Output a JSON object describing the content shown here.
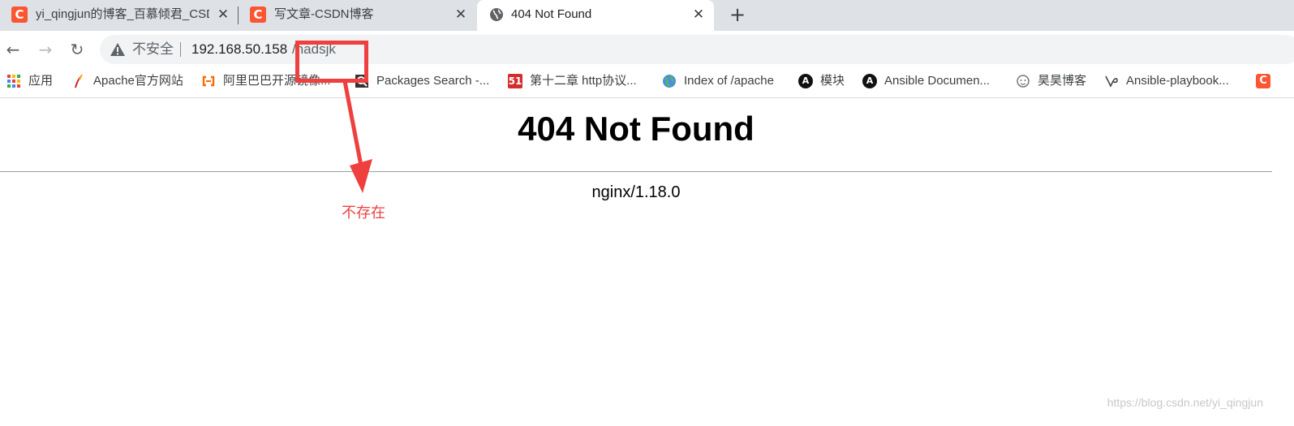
{
  "tabs": [
    {
      "title": "yi_qingjun的博客_百慕倾君_CSD",
      "favicon": "csdn-icon",
      "active": false
    },
    {
      "title": "写文章-CSDN博客",
      "favicon": "csdn-icon",
      "active": false
    },
    {
      "title": "404 Not Found",
      "favicon": "globe-icon",
      "active": true
    }
  ],
  "tab_strip": {
    "close_glyph": "✕",
    "new_tab_glyph": "+"
  },
  "toolbar": {
    "back_glyph": "←",
    "forward_glyph": "→",
    "reload_glyph": "↻"
  },
  "omnibox": {
    "security_label": "不安全",
    "url_host": "192.168.50.158",
    "url_path": "/nadsjk"
  },
  "bookmarks": [
    {
      "label": "应用",
      "icon": "apps-grid-icon"
    },
    {
      "label": "Apache官方网站",
      "icon": "apache-feather-icon"
    },
    {
      "label": "阿里巴巴开源镜像...",
      "icon": "aliyun-icon"
    },
    {
      "label": "Packages Search -...",
      "icon": "packages-icon"
    },
    {
      "label": "第十二章 http协议...",
      "icon": "51cto-icon"
    },
    {
      "label": "Index of /apache",
      "icon": "globe-icon"
    },
    {
      "label": "模块",
      "icon": "ansible-icon"
    },
    {
      "label": "Ansible Documen...",
      "icon": "ansible-icon"
    },
    {
      "label": "昊昊博客",
      "icon": "face-icon"
    },
    {
      "label": "Ansible-playbook...",
      "icon": "ansible-v-icon"
    },
    {
      "label": "",
      "icon": "csdn-icon"
    }
  ],
  "bookmark_glyphs": {
    "ansible": "A",
    "five_one": "51",
    "csdn": "C"
  },
  "page": {
    "heading": "404 Not Found",
    "server": "nginx/1.18.0"
  },
  "annotation": {
    "text": "不存在",
    "color": "#ef3f3f"
  },
  "watermark": "https://blog.csdn.net/yi_qingjun",
  "colors": {
    "tab_strip": "#dee1e6",
    "omnibox": "#f1f3f4",
    "csdn_brand": "#fc5531",
    "annotation_red": "#ef3f3f"
  }
}
